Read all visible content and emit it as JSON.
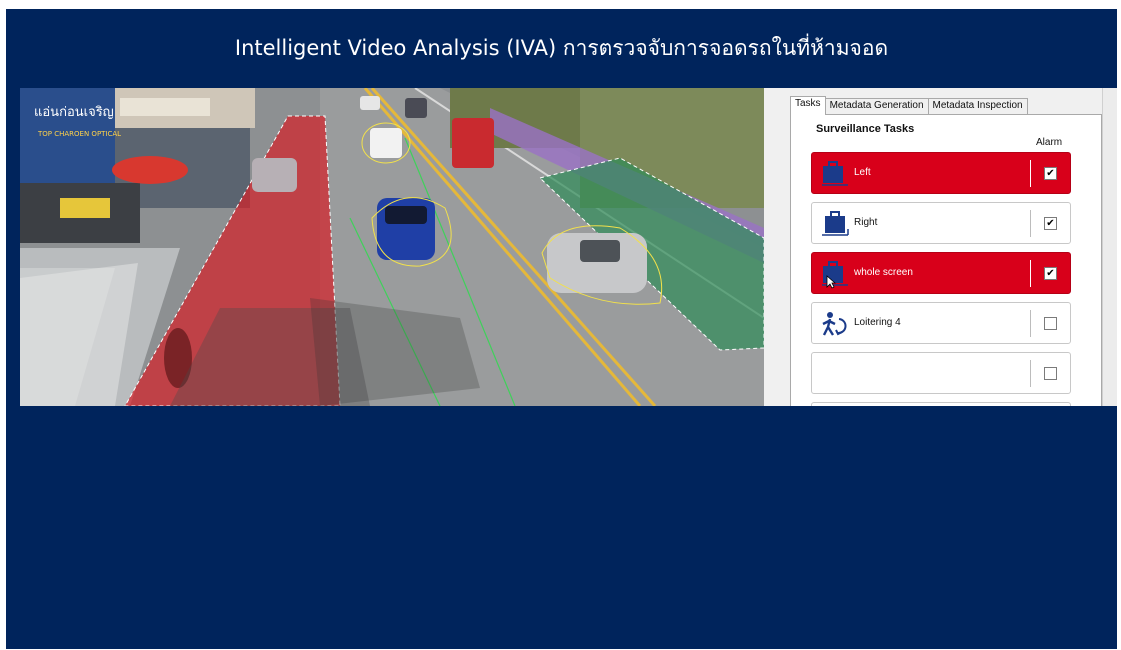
{
  "slide": {
    "title": "Intelligent Video Analysis (IVA) การตรวจจับการจอดรถในที่ห้ามจอด",
    "background": "#00245c"
  },
  "video": {
    "shop_sign": "แอ่นก่อนเจริญ",
    "shop_subsign": "TOP CHAROEN OPTICAL",
    "zone_colors": {
      "no_parking_zone": "#d2232a",
      "green_zone": "#2e8b57",
      "object_outline": "#f2e14b",
      "track_line": "#3fd15a"
    }
  },
  "panel": {
    "tabs": [
      {
        "label": "Tasks",
        "active": true
      },
      {
        "label": "Metadata Generation",
        "active": false
      },
      {
        "label": "Metadata Inspection",
        "active": false
      }
    ],
    "section_title": "Surveillance Tasks",
    "alarm_header": "Alarm",
    "tasks": [
      {
        "label": "Left",
        "icon": "object-left-icon",
        "highlighted": true,
        "checked": true,
        "check_glyph": "✔"
      },
      {
        "label": "Right",
        "icon": "object-right-icon",
        "highlighted": false,
        "checked": true,
        "check_glyph": "✔"
      },
      {
        "label": "whole screen",
        "icon": "object-left-icon",
        "highlighted": true,
        "checked": true,
        "check_glyph": "✔"
      },
      {
        "label": "Loitering 4",
        "icon": "loitering-icon",
        "highlighted": false,
        "checked": false,
        "check_glyph": ""
      },
      {
        "label": "",
        "icon": "",
        "highlighted": false,
        "checked": false,
        "check_glyph": ""
      }
    ],
    "highlight_color": "#d8001a"
  }
}
